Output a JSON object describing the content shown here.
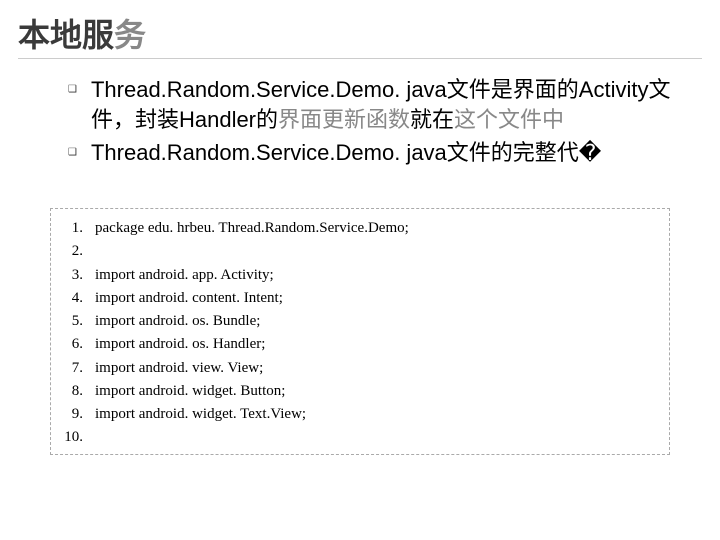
{
  "title_pre": "本地服",
  "title_gray": "务",
  "bullets": [
    {
      "parts": [
        {
          "t": "Thread.Random.Service.Demo. java文件是界面的Activity文件，封装Handler的",
          "gray": false
        },
        {
          "t": "界面更新函数",
          "gray": true
        },
        {
          "t": "就在",
          "gray": false
        },
        {
          "t": "这个文件中",
          "gray": true
        }
      ]
    },
    {
      "parts": [
        {
          "t": "Thread.Random.Service.Demo. java文件的完整代�",
          "gray": false
        }
      ]
    }
  ],
  "code": [
    {
      "n": "1.",
      "t": "package edu. hrbeu. Thread.Random.Service.Demo;"
    },
    {
      "n": "2.",
      "t": ""
    },
    {
      "n": "3.",
      "t": "import android. app. Activity;"
    },
    {
      "n": "4.",
      "t": "import android. content. Intent;"
    },
    {
      "n": "5.",
      "t": "import android. os. Bundle;"
    },
    {
      "n": "6.",
      "t": "import android. os. Handler;"
    },
    {
      "n": "7.",
      "t": "import android. view. View;"
    },
    {
      "n": "8.",
      "t": "import android. widget. Button;"
    },
    {
      "n": "9.",
      "t": "import android. widget. Text.View;"
    },
    {
      "n": "10.",
      "t": ""
    }
  ]
}
